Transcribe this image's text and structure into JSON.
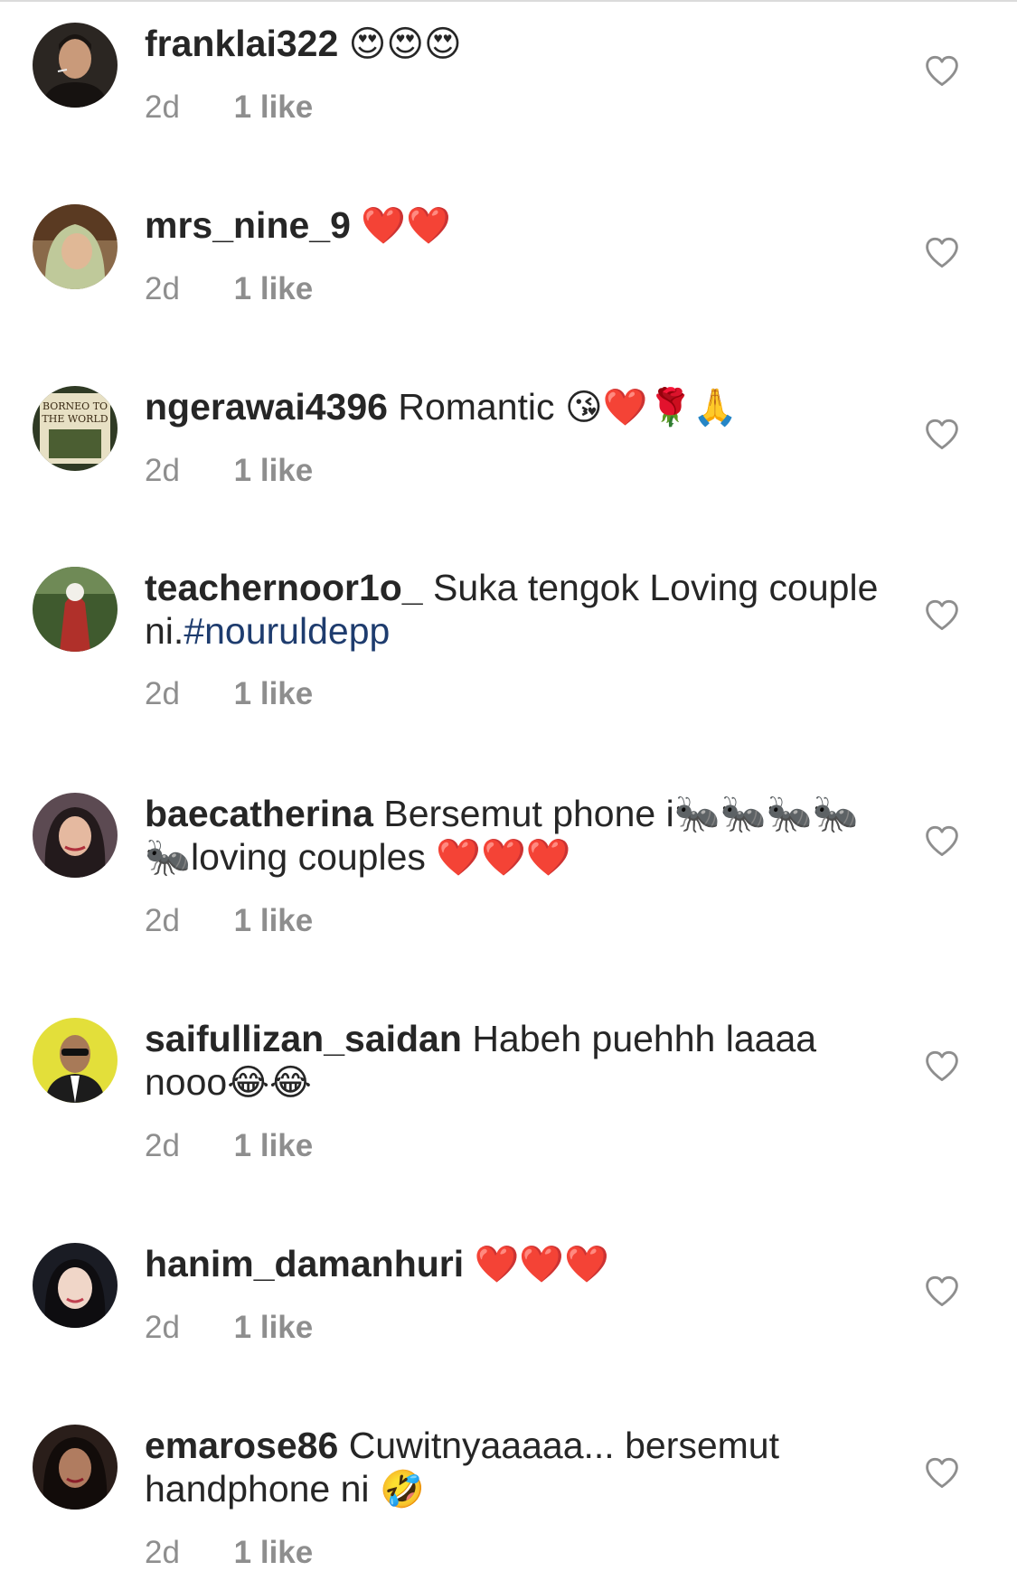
{
  "comments": [
    {
      "username": "franklai322",
      "text": "",
      "emoji": "😍😍😍",
      "hashtag": "",
      "age": "2d",
      "likes": "1 like",
      "avatar_icon": "avatar-man-dark-outfit-icon"
    },
    {
      "username": "mrs_nine_9",
      "text": "",
      "emoji": "❤️❤️",
      "hashtag": "",
      "age": "2d",
      "likes": "1 like",
      "avatar_icon": "avatar-woman-hijab-icon"
    },
    {
      "username": "ngerawai4396",
      "text": "Romantic",
      "emoji": "😘❤️🌹🙏",
      "hashtag": "",
      "age": "2d",
      "likes": "1 like",
      "avatar_icon": "avatar-book-cover-icon",
      "avatar_caption": "BORNEO TO THE WORLD"
    },
    {
      "username": "teachernoor1o_",
      "text": "Suka tengok Loving couple ni.",
      "emoji": "",
      "hashtag": "#nouruldepp",
      "age": "2d",
      "likes": "1 like",
      "avatar_icon": "avatar-woman-red-dress-icon"
    },
    {
      "username": "baecatherina",
      "text": "Bersemut phone i🐜🐜🐜🐜🐜loving couples",
      "emoji": "❤️❤️❤️",
      "hashtag": "",
      "age": "2d",
      "likes": "1 like",
      "avatar_icon": "avatar-woman-dark-hair-icon"
    },
    {
      "username": "saifullizan_saidan",
      "text": "Habeh puehhh laaaa nooo",
      "emoji": "😂😂",
      "hashtag": "",
      "age": "2d",
      "likes": "1 like",
      "avatar_icon": "avatar-man-sunglasses-icon"
    },
    {
      "username": "hanim_damanhuri",
      "text": "",
      "emoji": "❤️❤️❤️",
      "hashtag": "",
      "age": "2d",
      "likes": "1 like",
      "avatar_icon": "avatar-woman-selfie-icon"
    },
    {
      "username": "emarose86",
      "text": "Cuwitnyaaaaa... bersemut handphone ni",
      "emoji": "🤣",
      "hashtag": "",
      "age": "2d",
      "likes": "1 like",
      "avatar_icon": "avatar-woman-dark-background-icon"
    }
  ],
  "colors": {
    "username": "#262626",
    "text": "#262626",
    "meta": "#8e8e8e",
    "hashtag": "#1e3c6e",
    "heart_outline": "#8e8e8e"
  }
}
